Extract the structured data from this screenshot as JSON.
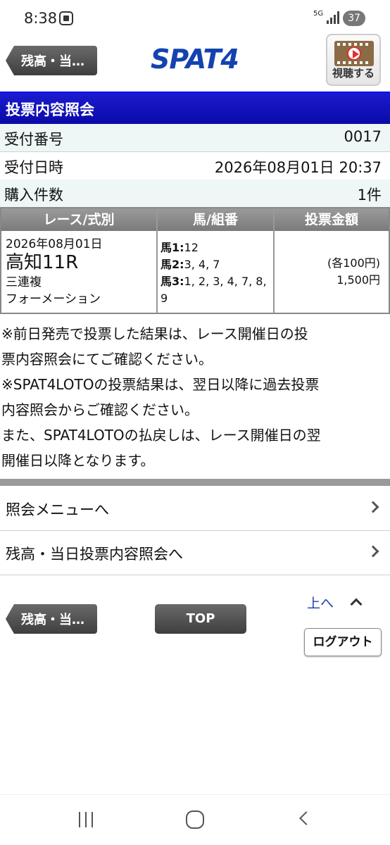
{
  "status_bar": {
    "time": "8:38",
    "network": "5G",
    "battery": "37"
  },
  "header": {
    "back_label": "残高・当…",
    "logo": "SPAT4",
    "watch_label": "視聴する",
    "brand_color": "#1443b0"
  },
  "page_title": "投票内容照会",
  "info": [
    {
      "label": "受付番号",
      "value": "0017"
    },
    {
      "label": "受付日時",
      "value": "2026年08月01日 20:37"
    },
    {
      "label": "購入件数",
      "value": "1件"
    }
  ],
  "table": {
    "headers": [
      "レース/式別",
      "馬/組番",
      "投票金額"
    ],
    "row": {
      "date": "2026年08月01日",
      "race": "高知11R",
      "bet_type": "三連複",
      "method": "フォーメーション",
      "horses": [
        {
          "label": "馬1:",
          "value": "12"
        },
        {
          "label": "馬2:",
          "value": "3, 4, 7"
        },
        {
          "label": "馬3:",
          "value": "1, 2, 3, 4, 7, 8,"
        }
      ],
      "horses_cont": "9",
      "amount_each": "(各100円)",
      "amount_total": "1,500円"
    }
  },
  "notes": [
    "※前日発売で投票した結果は、レース開催日の投",
    "票内容照会にてご確認ください。",
    "※SPAT4LOTOの投票結果は、翌日以降に過去投票",
    "内容照会からご確認ください。",
    "また、SPAT4LOTOの払戻しは、レース開催日の翌",
    "開催日以降となります。"
  ],
  "menu": [
    {
      "label": "照会メニューへ"
    },
    {
      "label": "残高・当日投票内容照会へ"
    }
  ],
  "footer": {
    "back_label": "残高・当…",
    "top_label": "TOP",
    "up_label": "上へ",
    "logout_label": "ログアウト"
  }
}
